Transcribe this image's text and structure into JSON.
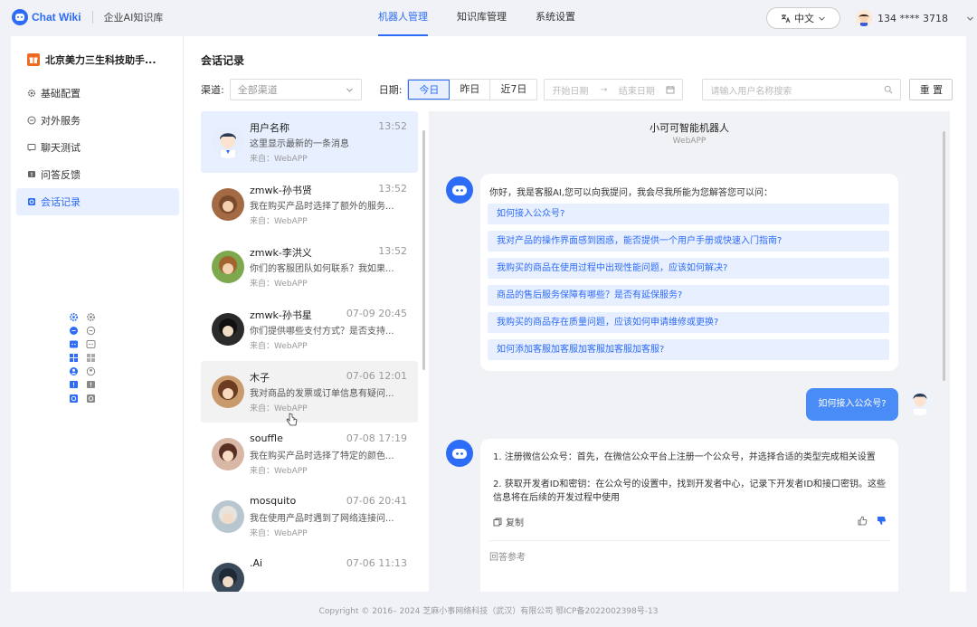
{
  "brand": {
    "name": "Chat Wiki",
    "subtitle": "企业AI知识库"
  },
  "nav": {
    "items": [
      {
        "label": "机器人管理",
        "active": true
      },
      {
        "label": "知识库管理",
        "active": false
      },
      {
        "label": "系统设置",
        "active": false
      }
    ]
  },
  "header": {
    "language": "中文",
    "phone": "134 **** 3718"
  },
  "sidebar": {
    "org_name": "北京美力三生科技助手...",
    "items": [
      {
        "label": "基础配置",
        "icon": "gear-icon",
        "active": false
      },
      {
        "label": "对外服务",
        "icon": "chat-circle-icon",
        "active": false
      },
      {
        "label": "聊天测试",
        "icon": "chat-test-icon",
        "active": false
      },
      {
        "label": "问答反馈",
        "icon": "feedback-icon",
        "active": false
      },
      {
        "label": "会话记录",
        "icon": "session-icon",
        "active": true
      }
    ]
  },
  "page": {
    "title": "会话记录"
  },
  "filters": {
    "channel_label": "渠道:",
    "channel_value": "全部渠道",
    "date_label": "日期:",
    "date_options": [
      "今日",
      "昨日",
      "近7日"
    ],
    "date_selected": "今日",
    "start_placeholder": "开始日期",
    "end_placeholder": "结束日期",
    "search_placeholder": "请输入用户名称搜索",
    "reset_label": "重 置"
  },
  "sessions": [
    {
      "name": "用户名称",
      "time": "13:52",
      "message": "这里显示最新的一条消息",
      "source": "来自：WebAPP"
    },
    {
      "name": "zmwk-孙书贤",
      "time": "13:52",
      "message": "我在购买产品时选择了额外的服务...",
      "source": "来自：WebAPP"
    },
    {
      "name": "zmwk-李洪义",
      "time": "13:52",
      "message": "你们的客服团队如何联系？我如果...",
      "source": "来自：WebAPP"
    },
    {
      "name": "zmwk-孙书星",
      "time": "07-09 20:45",
      "message": "你们提供哪些支付方式？是否支持...",
      "source": "来自：WebAPP"
    },
    {
      "name": "木子",
      "time": "07-06 12:01",
      "message": "我对商品的发票或订单信息有疑问...",
      "source": "来自：WebAPP"
    },
    {
      "name": "souffle",
      "time": "07-08 17:19",
      "message": "我在购买产品时选择了特定的颜色...",
      "source": "来自：WebAPP"
    },
    {
      "name": "mosquito",
      "time": "07-06 20:41",
      "message": "我在使用产品时遇到了网络连接问...",
      "source": "来自：WebAPP"
    },
    {
      "name": ".Ai",
      "time": "07-06 11:13",
      "message": "",
      "source": ""
    }
  ],
  "chat": {
    "bot_name": "小可可智能机器人",
    "channel": "WebAPP",
    "greeting": "你好，我是客服AI,您可以向我提问，我会尽我所能为您解答您可以问：",
    "suggestions": [
      "如何接入公众号?",
      "我对产品的操作界面感到困惑，能否提供一个用户手册或快速入门指南?",
      "我购买的商品在使用过程中出现性能问题，应该如何解决?",
      "商品的售后服务保障有哪些？是否有延保服务?",
      "我购买的商品存在质量问题，应该如何申请维修或更换?",
      "如何添加客服加客服加客服加客服加客服?"
    ],
    "user_message": "如何接入公众号?",
    "answer_1": "1. 注册微信公众号：首先，在微信公众平台上注册一个公众号，并选择合适的类型完成相关设置",
    "answer_2": "2. 获取开发者ID和密钥：在公众号的设置中，找到开发者中心，记录下开发者ID和接口密钥。这些信息将在后续的开发过程中使用",
    "copy_label": "复制",
    "ref_label": "回答参考"
  },
  "footer": "Copyright © 2016– 2024 芝麻小事网络科技（武汉）有限公司 鄂ICP备2022002398号-13",
  "colors": {
    "accent": "#2d6cf6",
    "active_bg": "#e8efff",
    "user_bubble": "#4a8cf7",
    "org_icon": "#f06a21"
  }
}
